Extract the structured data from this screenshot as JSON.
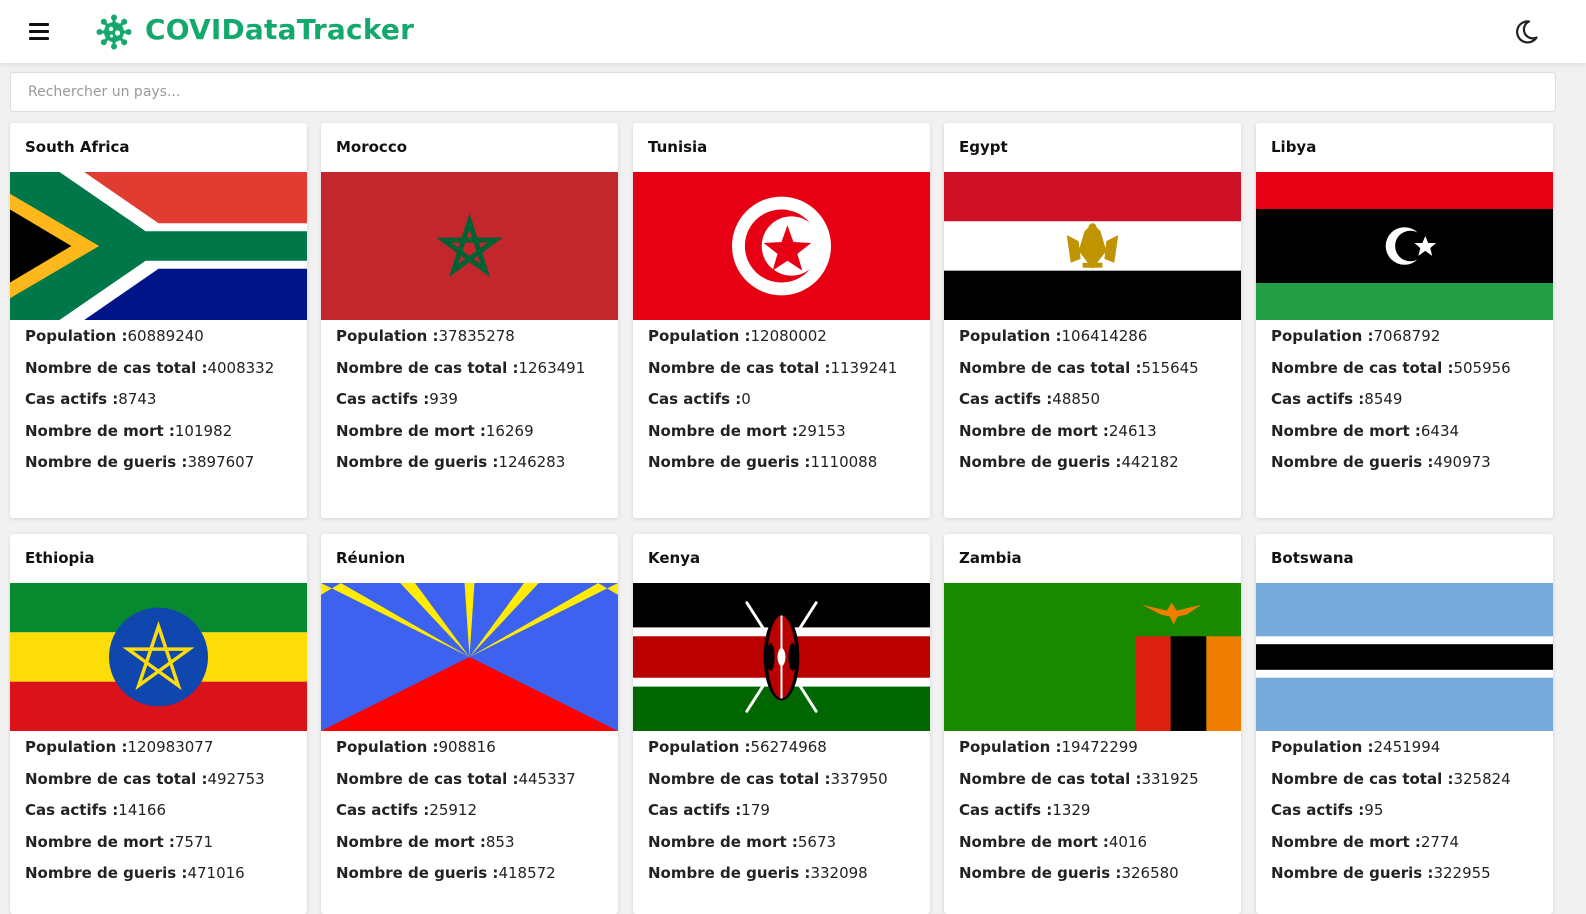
{
  "header": {
    "brand": "COVIDataTracker",
    "menu_icon": "hamburger-menu-icon",
    "logo_icon": "virus-icon",
    "theme_icon": "moon-icon",
    "brand_color": "#13a86c"
  },
  "search": {
    "placeholder": "Rechercher un pays..."
  },
  "labels": {
    "population": "Population :",
    "total_cases": "Nombre de cas total :",
    "active": "Cas actifs :",
    "deaths": "Nombre de mort :",
    "recovered": "Nombre de gueris :"
  },
  "countries": [
    {
      "name": "South Africa",
      "population": "60889240",
      "total_cases": "4008332",
      "active": "8743",
      "deaths": "101982",
      "recovered": "3897607"
    },
    {
      "name": "Morocco",
      "population": "37835278",
      "total_cases": "1263491",
      "active": "939",
      "deaths": "16269",
      "recovered": "1246283"
    },
    {
      "name": "Tunisia",
      "population": "12080002",
      "total_cases": "1139241",
      "active": "0",
      "deaths": "29153",
      "recovered": "1110088"
    },
    {
      "name": "Egypt",
      "population": "106414286",
      "total_cases": "515645",
      "active": "48850",
      "deaths": "24613",
      "recovered": "442182"
    },
    {
      "name": "Libya",
      "population": "7068792",
      "total_cases": "505956",
      "active": "8549",
      "deaths": "6434",
      "recovered": "490973"
    },
    {
      "name": "Ethiopia",
      "population": "120983077",
      "total_cases": "492753",
      "active": "14166",
      "deaths": "7571",
      "recovered": "471016"
    },
    {
      "name": "Réunion",
      "population": "908816",
      "total_cases": "445337",
      "active": "25912",
      "deaths": "853",
      "recovered": "418572"
    },
    {
      "name": "Kenya",
      "population": "56274968",
      "total_cases": "337950",
      "active": "179",
      "deaths": "5673",
      "recovered": "332098"
    },
    {
      "name": "Zambia",
      "population": "19472299",
      "total_cases": "331925",
      "active": "1329",
      "deaths": "4016",
      "recovered": "326580"
    },
    {
      "name": "Botswana",
      "population": "2451994",
      "total_cases": "325824",
      "active": "95",
      "deaths": "2774",
      "recovered": "322955"
    }
  ]
}
